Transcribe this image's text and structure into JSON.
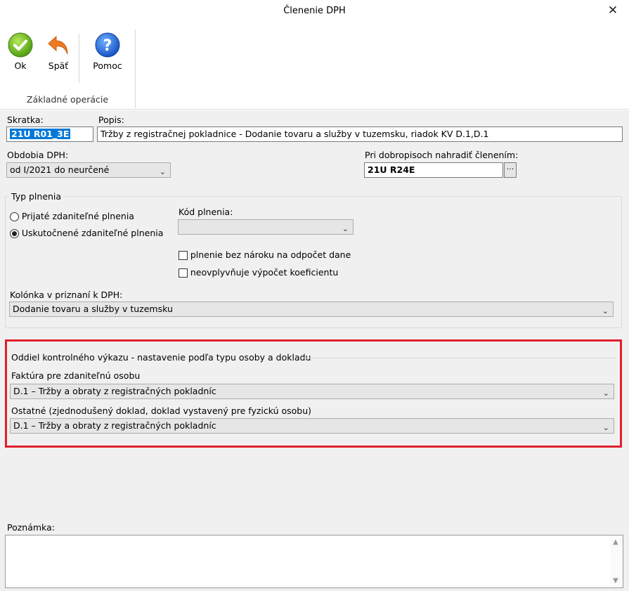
{
  "window": {
    "title": "Členenie DPH",
    "close_glyph": "✕"
  },
  "ribbon": {
    "ok_label": "Ok",
    "back_label": "Späť",
    "help_label": "Pomoc",
    "group_label": "Základné operácie"
  },
  "form": {
    "skratka_label": "Skratka:",
    "skratka_value": "21U R01_3E",
    "popis_label": "Popis:",
    "popis_value": "Tržby z registračnej pokladnice - Dodanie tovaru a služby  v tuzemsku, riadok KV D.1,D.1",
    "obdobia_label": "Obdobia DPH:",
    "obdobia_value": "od I/2021 do neurčené",
    "dobropis_label": "Pri dobropisoch nahradiť členením:",
    "dobropis_value": "21U R24E",
    "dobropis_button": "···",
    "typ_group_label": "Typ plnenia",
    "radio_prijate": "Prijaté zdaniteľné plnenia",
    "radio_uskutocnene": "Uskutočnené zdaniteľné plnenia",
    "radio_selected": "uskutocnene",
    "kod_label": "Kód plnenia:",
    "kod_value": "",
    "chk_bez_naroku": "plnenie bez nároku na odpočet dane",
    "chk_neovplyvnuje": "neovplyvňuje výpočet koeficientu",
    "kolonka_label": "Kolónka v priznaní k DPH:",
    "kolonka_value": "Dodanie tovaru a služby v tuzemsku",
    "oddiel_group_label": "Oddiel kontrolného výkazu - nastavenie podľa typu osoby a dokladu",
    "faktura_label": "Faktúra pre zdaniteľnú osobu",
    "faktura_value": "D.1 – Tržby a obraty z registračných pokladníc",
    "ostatne_label": "Ostatné (zjednodušený doklad, doklad vystavený pre fyzickú osobu)",
    "ostatne_value": "D.1 – Tržby a obraty z registračných pokladníc",
    "poznamka_label": "Poznámka:",
    "poznamka_value": ""
  },
  "colors": {
    "highlight_box": "#e0202b",
    "selection": "#0078d7"
  }
}
